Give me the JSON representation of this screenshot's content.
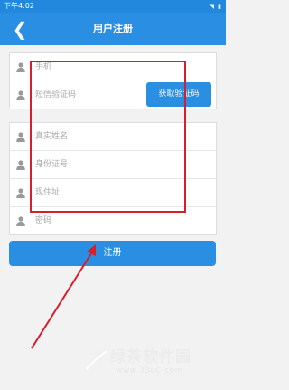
{
  "status_bar": {
    "time": "下午4:02",
    "icons": "◥ ▮"
  },
  "header": {
    "title": "用户注册",
    "back_glyph": "❮"
  },
  "form": {
    "group1": [
      {
        "placeholder": "手机"
      },
      {
        "placeholder": "短信验证码"
      }
    ],
    "group2": [
      {
        "placeholder": "真实姓名"
      },
      {
        "placeholder": "身份证号"
      },
      {
        "placeholder": "现住址"
      },
      {
        "placeholder": "密码"
      }
    ],
    "get_code_label": "获取验证码",
    "register_label": "注册"
  },
  "watermark": {
    "name": "绿茶软件园",
    "url": "www.33LC.com"
  },
  "colors": {
    "primary": "#2a8fe3",
    "annotation": "#d81e2a"
  },
  "icons": {
    "field": "user-icon",
    "back": "back-arrow-icon"
  }
}
